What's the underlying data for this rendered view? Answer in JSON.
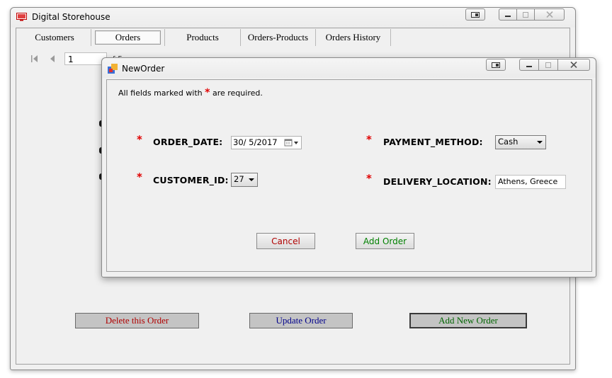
{
  "main_window": {
    "title": "Digital Storehouse",
    "menu": [
      {
        "label": "Customers",
        "name": "menu-customers",
        "active": false
      },
      {
        "label": "Orders",
        "name": "menu-orders",
        "active": true
      },
      {
        "label": "Products",
        "name": "menu-products",
        "active": false
      },
      {
        "label": "Orders-Products",
        "name": "menu-orders-products",
        "active": false
      },
      {
        "label": "Orders History",
        "name": "menu-orders-history",
        "active": false
      }
    ],
    "navigator": {
      "position": "1",
      "of_text": "of 5"
    },
    "buttons": {
      "delete_label": "Delete this Order",
      "update_label": "Update Order",
      "add_label": "Add New Order"
    }
  },
  "dialog": {
    "title": "NewOrder",
    "required_note_prefix": "All fields marked with",
    "required_note_star": "*",
    "required_note_suffix": "are required.",
    "fields": {
      "order_date": {
        "label": "ORDER_DATE:",
        "value": "30/ 5/2017"
      },
      "customer_id": {
        "label": "CUSTOMER_ID:",
        "value": "27"
      },
      "payment_method": {
        "label": "PAYMENT_METHOD:",
        "value": "Cash"
      },
      "delivery_location": {
        "label": "DELIVERY_LOCATION:",
        "value": "Athens, Greece"
      }
    },
    "cancel_label": "Cancel",
    "add_order_label": "Add Order"
  },
  "colors": {
    "delete_text": "#b00000",
    "update_text": "#00008b",
    "add_text": "#006400",
    "cancel_text": "#b00000",
    "add_order_text": "#008000",
    "required_star": "#e00000"
  }
}
